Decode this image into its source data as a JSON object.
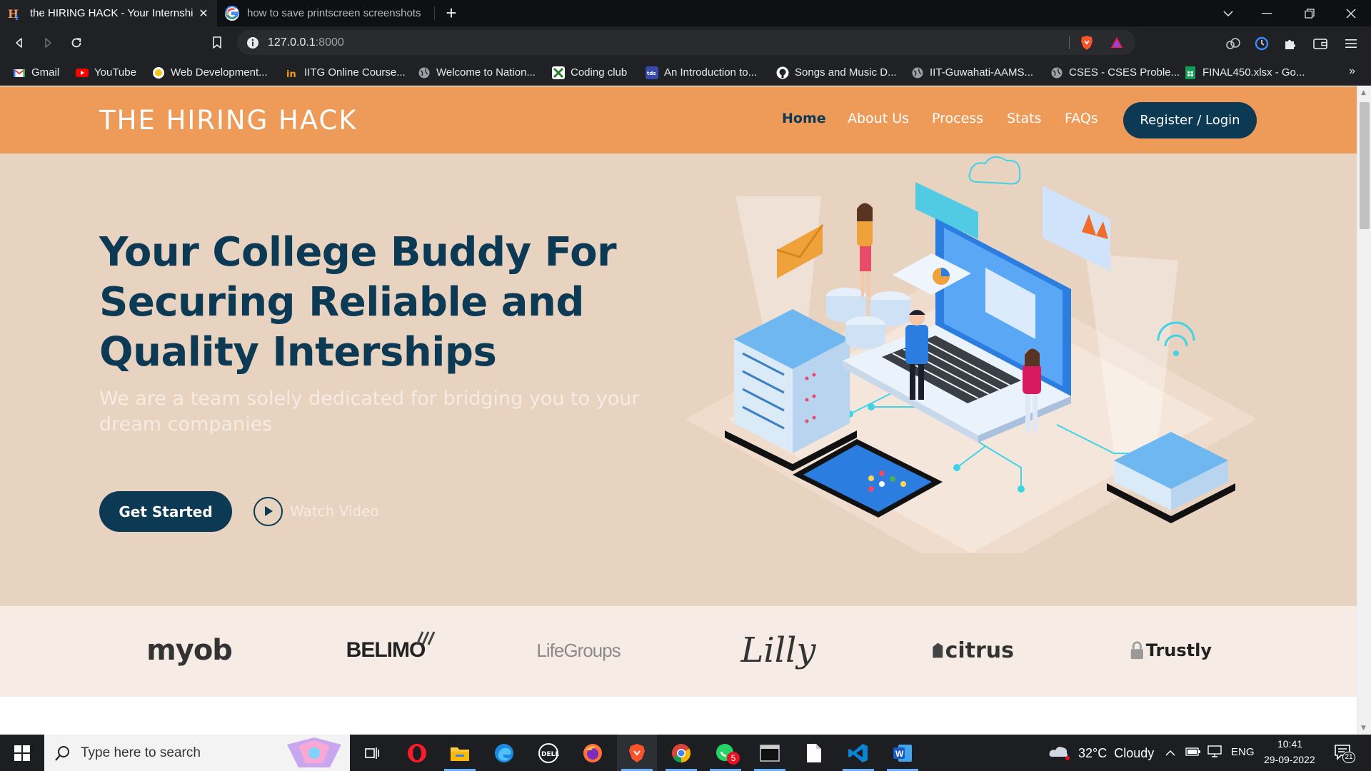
{
  "browser": {
    "tabs": [
      {
        "title": "the HIRING HACK - Your Internship",
        "active": true
      },
      {
        "title": "how to save printscreen screenshots in",
        "active": false
      }
    ],
    "address": {
      "host": "127.0.0.1",
      "port": ":8000"
    },
    "bookmarks": [
      {
        "label": "Gmail",
        "icon": "gmail-icon",
        "color": "#ea4335"
      },
      {
        "label": "YouTube",
        "icon": "youtube-icon",
        "color": "#ff0000"
      },
      {
        "label": "Web Development...",
        "icon": "web-dev-icon",
        "color": "#f5c518"
      },
      {
        "label": "IITG Online Course...",
        "icon": "iitg-icon",
        "color": "#f39c12"
      },
      {
        "label": "Welcome to Nation...",
        "icon": "globe-icon",
        "color": "#9aa0a6"
      },
      {
        "label": "Coding club",
        "icon": "coding-club-icon",
        "color": "#2e7d32"
      },
      {
        "label": "An Introduction to...",
        "icon": "tds-icon",
        "color": "#3949ab"
      },
      {
        "label": "Songs and Music D...",
        "icon": "github-icon",
        "color": "#24292e"
      },
      {
        "label": "IIT-Guwahati-AAMS...",
        "icon": "globe-icon",
        "color": "#9aa0a6"
      },
      {
        "label": "CSES - CSES Proble...",
        "icon": "globe-icon",
        "color": "#9aa0a6"
      },
      {
        "label": "FINAL450.xlsx - Go...",
        "icon": "sheets-icon",
        "color": "#0f9d58"
      }
    ],
    "bookmarks_more": "»"
  },
  "site": {
    "logo": "THE HIRING HACK",
    "nav": [
      "Home",
      "About Us",
      "Process",
      "Stats",
      "FAQs"
    ],
    "register_label": "Register / Login",
    "hero": {
      "title": "Your College Buddy For Securing Reliable and Quality Interships",
      "subtitle": "We are a team solely dedicated for bridging you to your dream companies",
      "cta": "Get Started",
      "watch": "Watch Video"
    },
    "clients": [
      "myob",
      "BELIMO",
      "LifeGroups",
      "Lilly",
      "citrus",
      "Trustly"
    ]
  },
  "taskbar": {
    "search_placeholder": "Type here to search",
    "weather": "32°C  Cloudy",
    "language": "ENG",
    "time": "10:41",
    "date": "29-09-2022",
    "whatsapp_badge": "5",
    "notifications": "21"
  },
  "colors": {
    "brand_orange": "#ee9a58",
    "brand_navy": "#0c3a55",
    "hero_bg": "#e8d2c0",
    "clients_bg": "#f6ece5"
  }
}
